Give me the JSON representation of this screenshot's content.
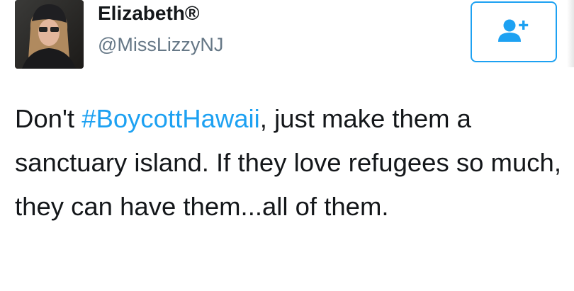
{
  "user": {
    "display_name": "Elizabeth®",
    "handle": "@MissLizzyNJ",
    "avatar_icon": "profile-photo"
  },
  "follow_button": {
    "icon": "follow-user-icon",
    "accent_color": "#1da1f2"
  },
  "tweet": {
    "text_before": "Don't ",
    "hashtag": "#BoycottHawaii",
    "text_after": ", just make them a sanctuary island. If they love refugees so much, they can have them...all of them.",
    "hashtag_color": "#1da1f2"
  }
}
